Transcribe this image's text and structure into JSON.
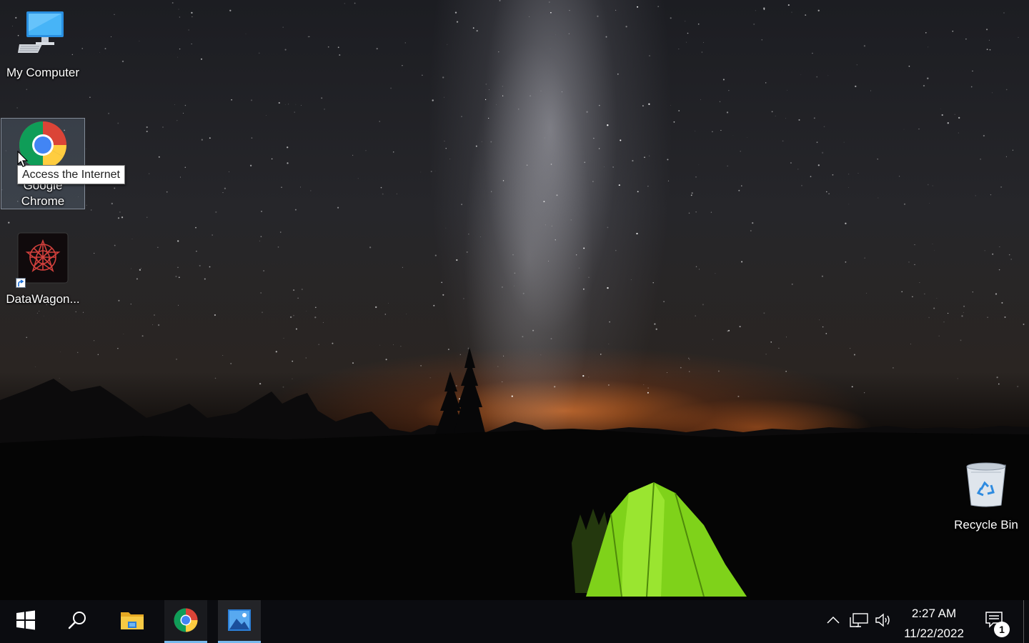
{
  "desktop": {
    "icons": [
      {
        "label": "My Computer",
        "icon": "computer-monitor-icon"
      },
      {
        "label": "Google Chrome",
        "icon": "chrome-icon",
        "selected": true
      },
      {
        "label": "DataWagon...",
        "icon": "datawagon-star-icon",
        "shortcut": true
      },
      {
        "label": "Recycle Bin",
        "icon": "recycle-bin-icon"
      }
    ],
    "tooltip": "Access the Internet"
  },
  "taskbar": {
    "buttons": [
      {
        "name": "start",
        "icon": "windows-logo-icon"
      },
      {
        "name": "search",
        "icon": "search-icon"
      },
      {
        "name": "file-explorer",
        "icon": "folder-icon"
      },
      {
        "name": "chrome",
        "icon": "chrome-icon",
        "running": true
      },
      {
        "name": "photos",
        "icon": "photos-icon",
        "running": true,
        "active": true
      }
    ],
    "tray": {
      "icons": [
        "chevron-up-icon",
        "network-icon",
        "volume-icon"
      ],
      "time": "2:27 AM",
      "date": "11/22/2022",
      "notification_count": "1"
    }
  },
  "colors": {
    "taskbar_bg": "#0b0c10",
    "running_indicator": "#76b9ed",
    "tent_green": "#7fd21a"
  }
}
